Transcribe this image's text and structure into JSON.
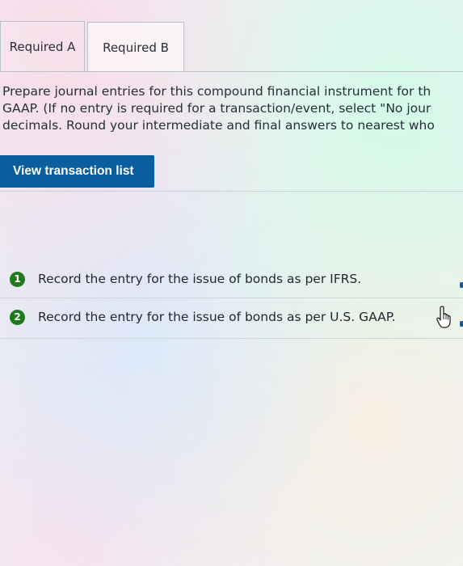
{
  "tabs": [
    {
      "label": "Required A",
      "active": true
    },
    {
      "label": "Required B",
      "active": false
    }
  ],
  "instructions": {
    "line1": "Prepare journal entries for this compound financial instrument for th",
    "line2": "GAAP. (If no entry is required for a transaction/event, select \"No jour",
    "line3": "decimals. Round your intermediate and final answers to nearest who"
  },
  "view_button": {
    "label": "View transaction list"
  },
  "transactions": [
    {
      "number": "1",
      "label": "Record the entry for the issue of bonds as per IFRS."
    },
    {
      "number": "2",
      "label": "Record the entry for the issue of bonds as per U.S. GAAP."
    }
  ],
  "colors": {
    "accent": "#0b5e9e",
    "badge": "#1f7a1f"
  },
  "icons": {
    "cursor": "hand-pointer-icon"
  }
}
